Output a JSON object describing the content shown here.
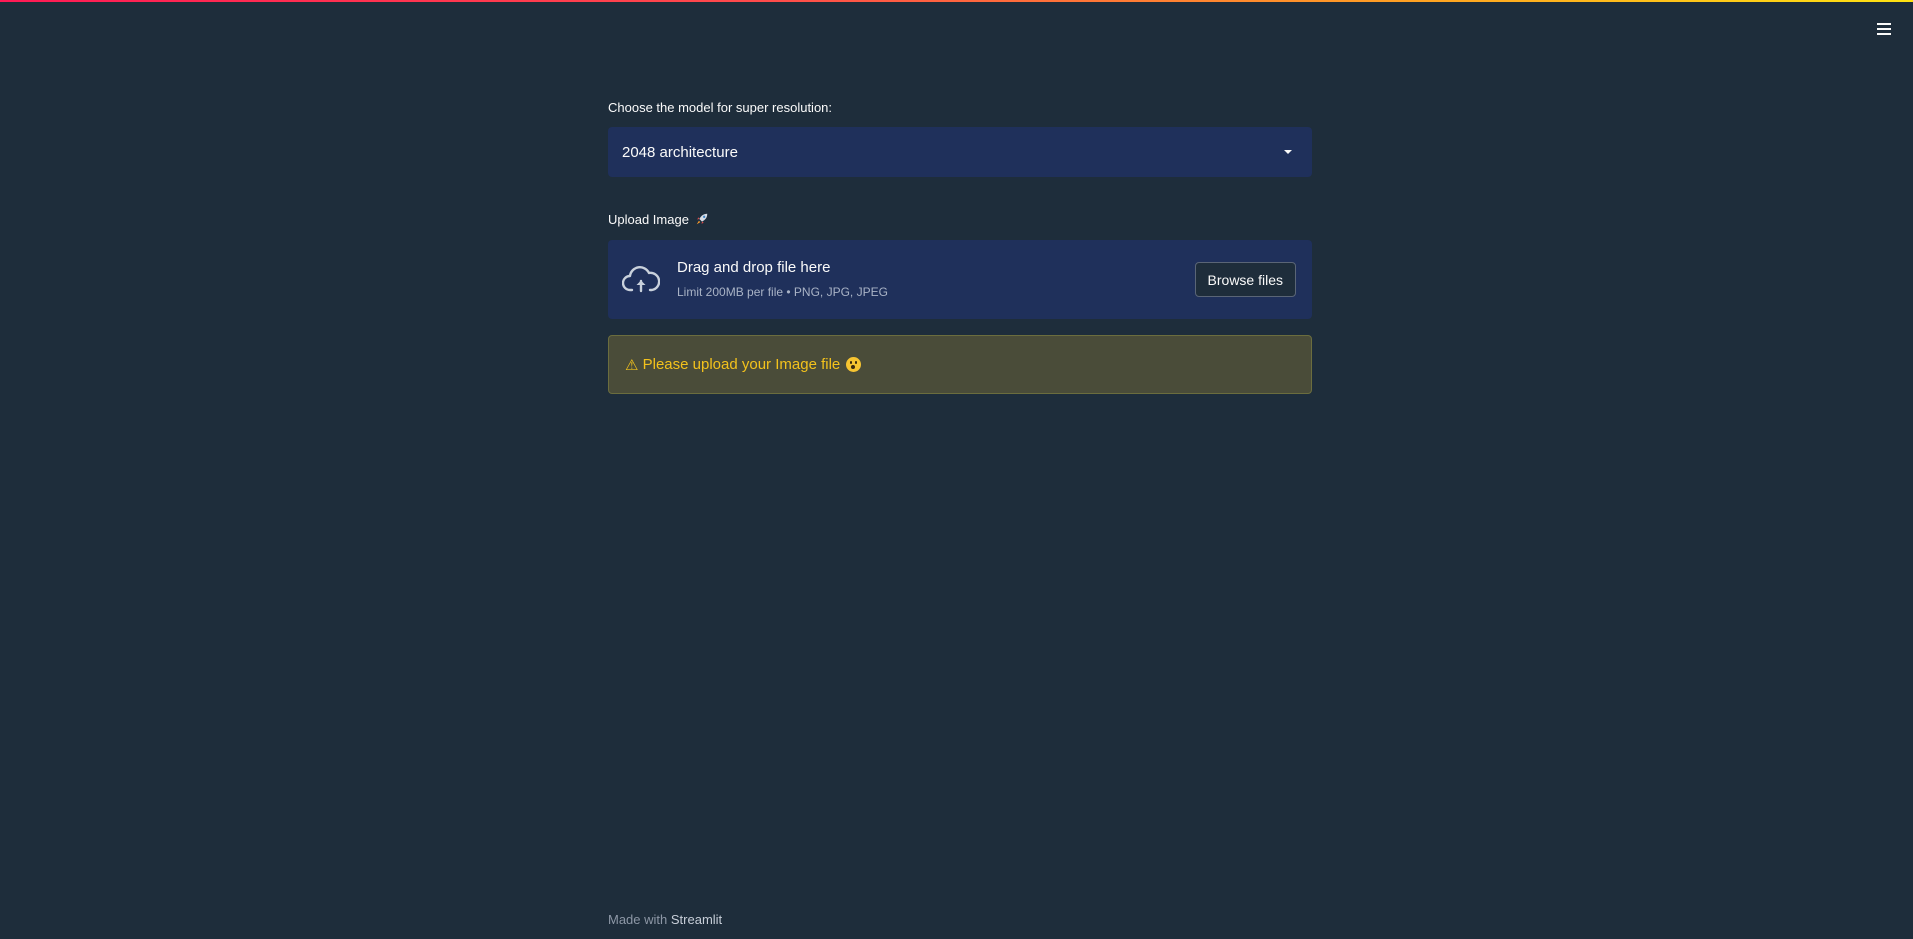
{
  "colors": {
    "background": "#1e2d3b",
    "input_bg": "#1f305b",
    "warning_bg": "#4a4c39",
    "warning_text": "#f3c21c",
    "accent_gradient": [
      "#ff1a55",
      "#ffa421",
      "#ffe312"
    ]
  },
  "header": {
    "menu_icon": "hamburger-menu-icon"
  },
  "model_select": {
    "label": "Choose the model for super resolution:",
    "selected": "2048 architecture",
    "icon": "chevron-down-icon"
  },
  "uploader": {
    "label": "Upload Image",
    "label_icon": "rocket-icon",
    "title": "Drag and drop file here",
    "subtitle": "Limit 200MB per file • PNG, JPG, JPEG",
    "button": "Browse files",
    "icon": "cloud-upload-icon"
  },
  "warning": {
    "icon": "warning-icon",
    "symbol": "⚠",
    "text": "Please upload your Image file",
    "emoji": "surprised-face-icon"
  },
  "footer": {
    "prefix": "Made with",
    "link": "Streamlit"
  }
}
